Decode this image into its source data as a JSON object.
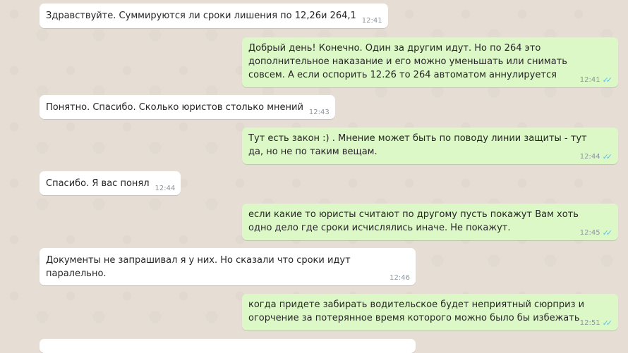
{
  "messages": [
    {
      "direction": "in",
      "text": "Здравствуйте. Суммируются ли сроки лишения по 12,26и 264,1",
      "time": "12:41"
    },
    {
      "direction": "out",
      "text": "Добрый день! Конечно. Один за другим идут. Но по 264 это дополнительное наказание и его можно уменьшать или снимать совсем. А если оспорить 12.26 то 264 автоматом аннулируется",
      "time": "12:41",
      "status": "read"
    },
    {
      "direction": "in",
      "text": "Понятно. Спасибо. Сколько юристов столько мнений",
      "time": "12:43"
    },
    {
      "direction": "out",
      "text": "Тут есть закон :) . Мнение может быть по поводу линии защиты - тут да, но не по таким вещам.",
      "time": "12:44",
      "status": "read"
    },
    {
      "direction": "in",
      "text": "Спасибо. Я вас понял",
      "time": "12:44"
    },
    {
      "direction": "out",
      "text": "если какие то юристы считают по другому пусть покажут Вам хоть одно дело где сроки исчислялись иначе. Не покажут.",
      "time": "12:45",
      "status": "read"
    },
    {
      "direction": "in",
      "text": "Документы не запрашивал я у них. Но сказали что сроки идут паралельно.",
      "time": "12:46"
    },
    {
      "direction": "out",
      "text": "когда придете забирать водительское будет неприятный сюрприз и огорчение за потерянное время которого можно было бы избежать",
      "time": "12:51",
      "status": "read"
    }
  ],
  "colors": {
    "incoming": "#ffffff",
    "outgoing": "#dcf8c6",
    "read_ticks": "#4fc3f7",
    "background": "#e6ded5"
  },
  "icons": {
    "read_status": "double-check-icon"
  }
}
